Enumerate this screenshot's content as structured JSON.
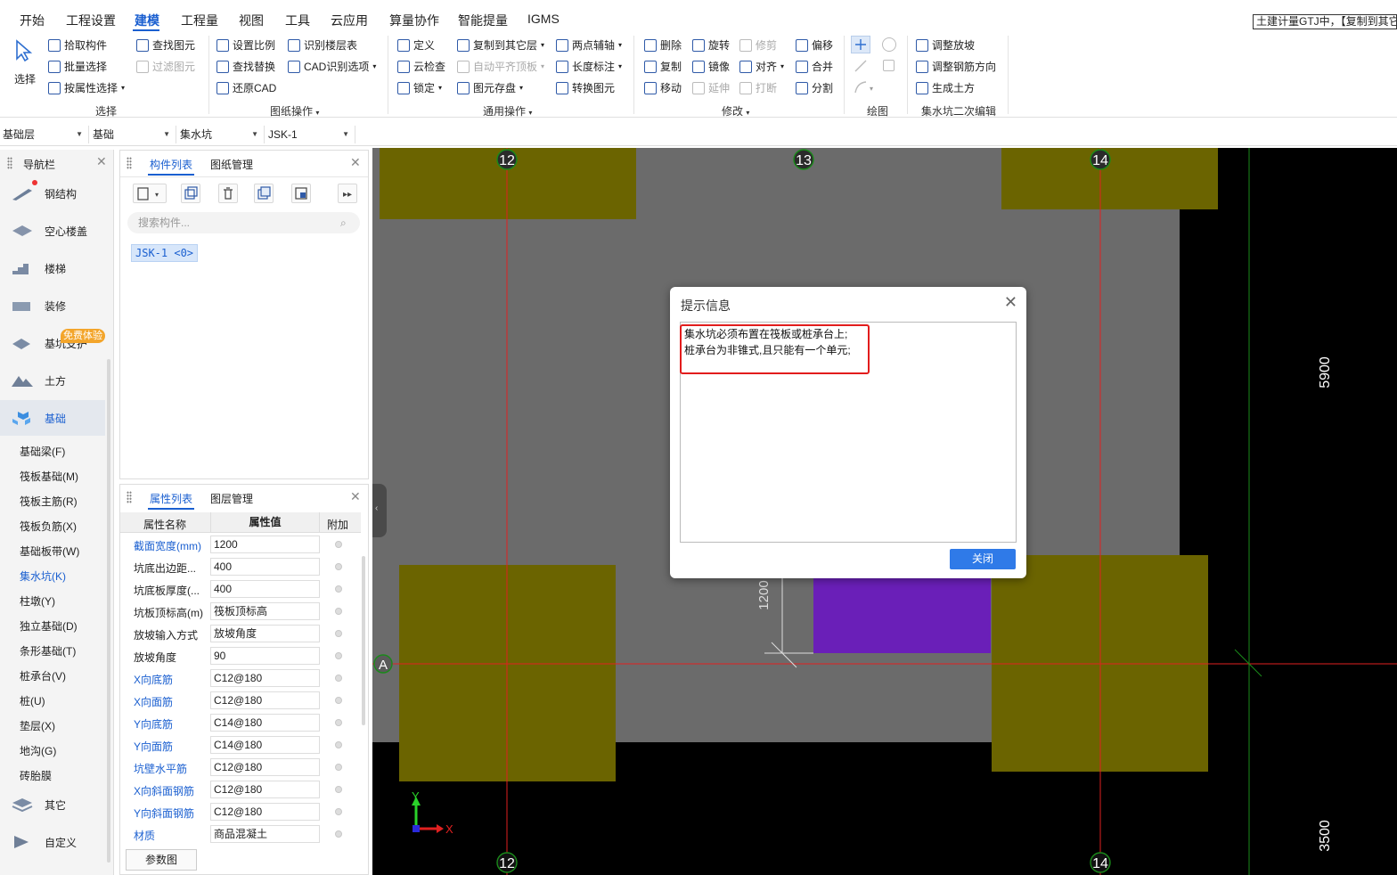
{
  "menubar": {
    "items": [
      "开始",
      "工程设置",
      "建模",
      "工程量",
      "视图",
      "工具",
      "云应用",
      "算量协作",
      "智能提量",
      "IGMS"
    ],
    "active": "建模",
    "title": "土建计量GTJ中，【复制到其它"
  },
  "ribbon": {
    "select": {
      "big": "选择",
      "pick": "拾取构件",
      "batch": "批量选择",
      "by_attr": "按属性选择",
      "find": "查找图元",
      "filter": "过滤图元",
      "label": "选择"
    },
    "drawing": {
      "set_scale": "设置比例",
      "find_replace": "查找替换",
      "restore_cad": "还原CAD",
      "identify_floor": "识别楼层表",
      "cad_options": "CAD识别选项",
      "label": "图纸操作"
    },
    "general": {
      "define": "定义",
      "cloud_check": "云检查",
      "lock": "锁定",
      "copy_other": "复制到其它层",
      "auto_align": "自动平齐顶板",
      "save_element": "图元存盘",
      "two_point_axis": "两点辅轴",
      "length_mark": "长度标注",
      "convert": "转换图元",
      "label": "通用操作"
    },
    "modify": {
      "delete": "删除",
      "copy": "复制",
      "move": "移动",
      "rotate": "旋转",
      "mirror": "镜像",
      "extend": "延伸",
      "trim": "修剪",
      "align": "对齐",
      "break": "打断",
      "offset": "偏移",
      "merge": "合并",
      "split": "分割",
      "label": "修改"
    },
    "draw_label": "绘图",
    "pit_edit": {
      "adjust_slope": "调整放坡",
      "adjust_rebar": "调整钢筋方向",
      "gen_earth": "生成土方",
      "label": "集水坑二次编辑"
    }
  },
  "toolbar2": {
    "floor": "基础层",
    "category": "基础",
    "type": "集水坑",
    "component": "JSK-1"
  },
  "nav": {
    "title": "导航栏",
    "categories": [
      "钢结构",
      "空心楼盖",
      "楼梯",
      "装修",
      "基坑支护",
      "土方",
      "基础"
    ],
    "badge": "免费体验",
    "subitems": [
      "基础梁(F)",
      "筏板基础(M)",
      "筏板主筋(R)",
      "筏板负筋(X)",
      "基础板带(W)",
      "集水坑(K)",
      "柱墩(Y)",
      "独立基础(D)",
      "条形基础(T)",
      "桩承台(V)",
      "桩(U)",
      "垫层(X)",
      "地沟(G)",
      "砖胎膜"
    ],
    "bottom": [
      "其它",
      "自定义"
    ]
  },
  "comp": {
    "tab1": "构件列表",
    "tab2": "图纸管理",
    "search_placeholder": "搜索构件...",
    "item": "JSK-1 <0>"
  },
  "props": {
    "tab1": "属性列表",
    "tab2": "图层管理",
    "col_name": "属性名称",
    "col_value": "属性值",
    "col_extra": "附加",
    "rows": [
      {
        "name": "截面宽度(mm)",
        "value": "1200",
        "blue": true
      },
      {
        "name": "坑底出边距...",
        "value": "400",
        "blue": false
      },
      {
        "name": "坑底板厚度(...",
        "value": "400",
        "blue": false
      },
      {
        "name": "坑板顶标高(m)",
        "value": "筏板顶标高",
        "blue": false
      },
      {
        "name": "放坡输入方式",
        "value": "放坡角度",
        "blue": false
      },
      {
        "name": "放坡角度",
        "value": "90",
        "blue": false
      },
      {
        "name": "X向底筋",
        "value": "C12@180",
        "blue": true
      },
      {
        "name": "X向面筋",
        "value": "C12@180",
        "blue": true
      },
      {
        "name": "Y向底筋",
        "value": "C14@180",
        "blue": true
      },
      {
        "name": "Y向面筋",
        "value": "C14@180",
        "blue": true
      },
      {
        "name": "坑壁水平筋",
        "value": "C12@180",
        "blue": true
      },
      {
        "name": "X向斜面钢筋",
        "value": "C12@180",
        "blue": true
      },
      {
        "name": "Y向斜面钢筋",
        "value": "C12@180",
        "blue": true
      },
      {
        "name": "材质",
        "value": "商品混凝土",
        "blue": true
      }
    ],
    "param_button": "参数图"
  },
  "canvas": {
    "axis_12": "12",
    "axis_13": "13",
    "axis_14": "14",
    "axis_a": "A",
    "dim_5900": "5900",
    "dim_3500": "3500",
    "dim_1200": "1200",
    "y_label": "Y",
    "x_label": "X",
    "colors": {
      "slab": "#6b6b6b",
      "pile_cap": "#6b6400",
      "pit": "#6a1fb8",
      "axis": "#e02020",
      "grid_green": "#1a8a1a"
    }
  },
  "dialog": {
    "title": "提示信息",
    "line1": "集水坑必须布置在筏板或桩承台上;",
    "line2": "桩承台为非锥式,且只能有一个单元;",
    "close_button": "关闭"
  }
}
